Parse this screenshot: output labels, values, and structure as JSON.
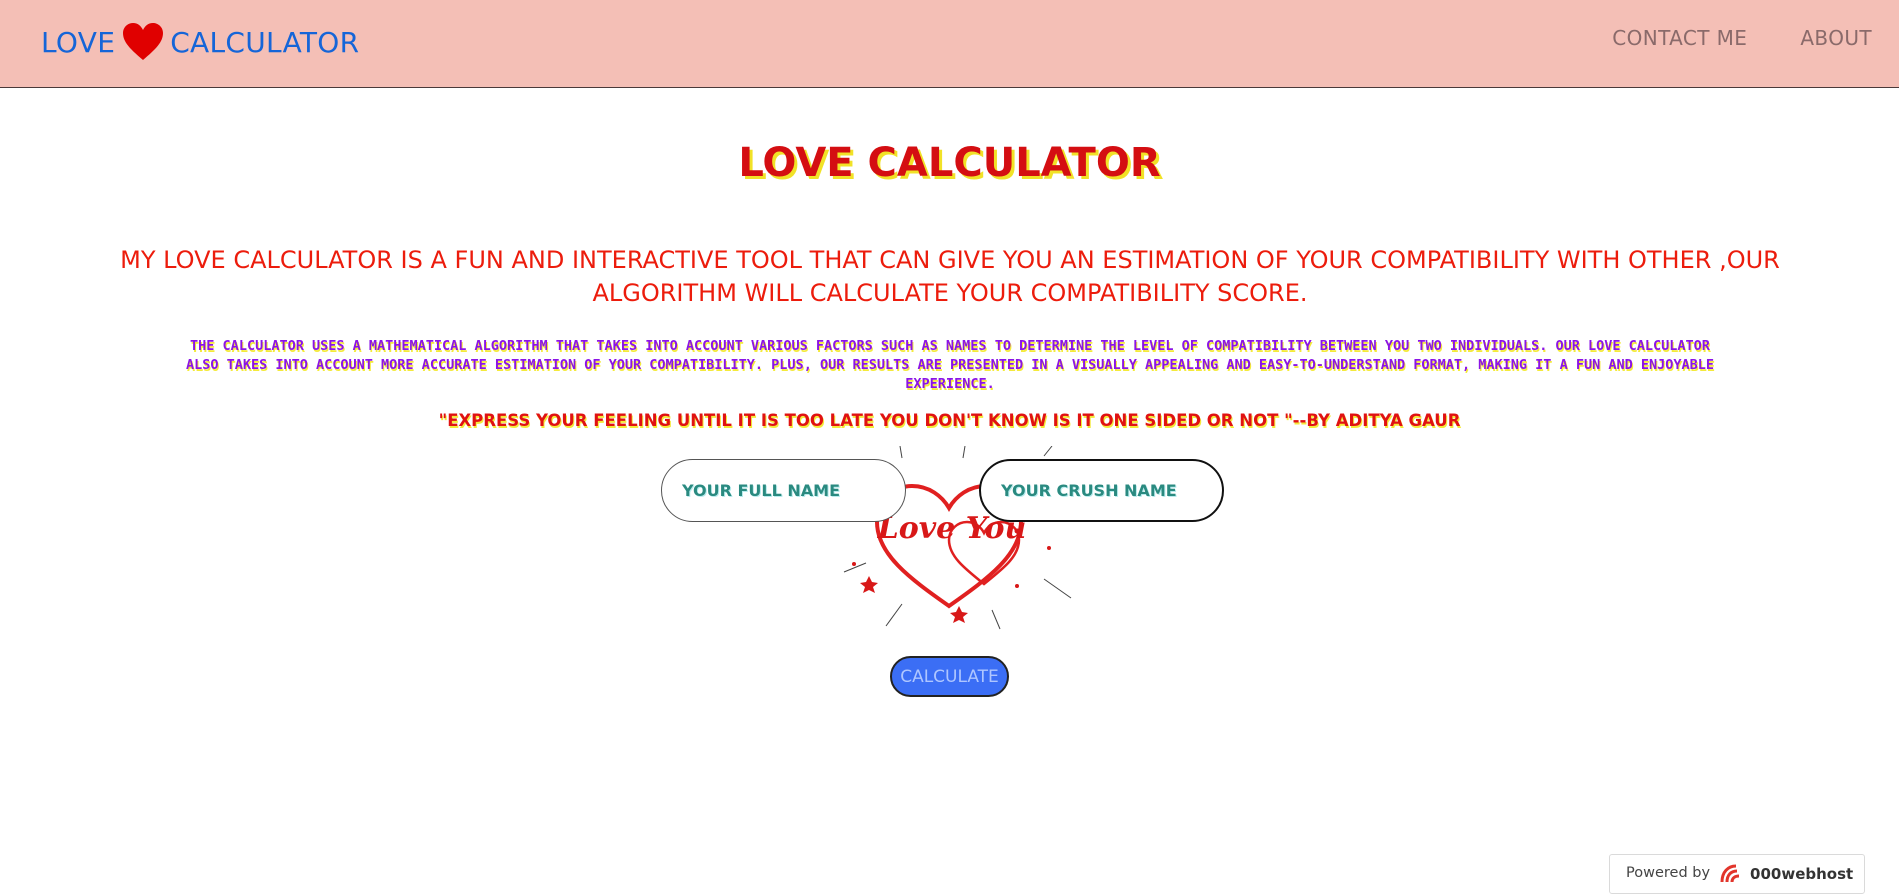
{
  "navbar": {
    "brand_left": "LOVE",
    "brand_right": "CALCULATOR",
    "links": [
      {
        "label": "CONTACT ME"
      },
      {
        "label": "ABOUT"
      }
    ]
  },
  "main": {
    "title": "LOVE CALCULATOR",
    "lead": "MY LOVE CALCULATOR IS A FUN AND INTERACTIVE TOOL THAT CAN GIVE YOU AN ESTIMATION OF YOUR COMPATIBILITY WITH OTHER ,OUR ALGORITHM WILL CALCULATE YOUR COMPATIBILITY SCORE.",
    "detail": "THE CALCULATOR USES A MATHEMATICAL ALGORITHM THAT TAKES INTO ACCOUNT VARIOUS FACTORS SUCH AS NAMES TO DETERMINE THE LEVEL OF COMPATIBILITY BETWEEN YOU TWO INDIVIDUALS. OUR LOVE CALCULATOR ALSO TAKES INTO ACCOUNT MORE ACCURATE ESTIMATION OF YOUR COMPATIBILITY. PLUS, OUR RESULTS ARE PRESENTED IN A VISUALLY APPEALING AND EASY-TO-UNDERSTAND FORMAT, MAKING IT A FUN AND ENJOYABLE EXPERIENCE.",
    "quote": "\"EXPRESS YOUR FEELING UNTIL IT IS TOO LATE YOU DON'T KNOW IS IT ONE SIDED OR NOT \"--BY ADITYA GAUR"
  },
  "form": {
    "full_name": {
      "value": "",
      "placeholder": "YOUR FULL NAME"
    },
    "crush_name": {
      "value": "",
      "placeholder": "YOUR CRUSH NAME"
    },
    "calculate_label": "CALCULATE"
  },
  "image": {
    "script_text": "Love You"
  },
  "footer": {
    "powered_by": "Powered by",
    "host_name": "000webhost"
  },
  "colors": {
    "navbar_bg": "#f4bfb6",
    "brand": "#1565d8",
    "title": "#d40e12",
    "title_shadow": "#f1e227",
    "lead": "#ec1c0c",
    "detail": "#8b14e6",
    "button": "#3b6ef5",
    "heart": "#e00000"
  },
  "icons": [
    "heart-icon",
    "love-you-heart-illustration",
    "000webhost-logo-icon"
  ]
}
